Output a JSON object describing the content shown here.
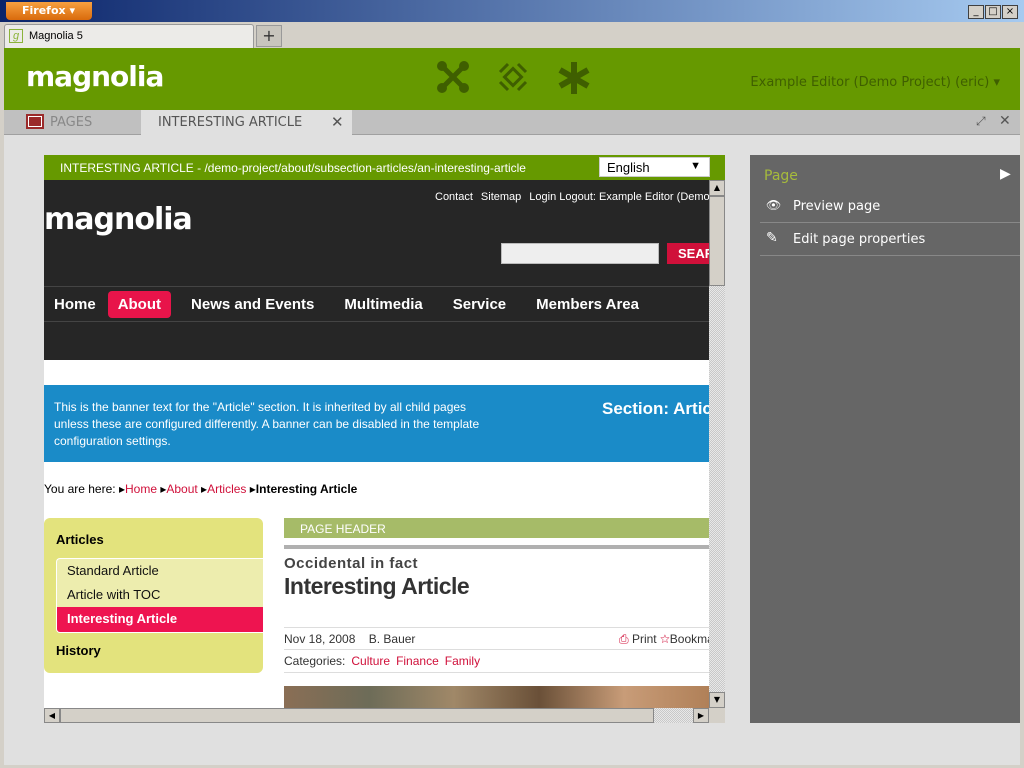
{
  "browser": {
    "menu_label": "Firefox",
    "tab_title": "Magnolia 5",
    "new_tab": "+",
    "win_min": "_",
    "win_max": "□",
    "win_close": "×"
  },
  "app": {
    "logo": "magnolia",
    "user": "Example Editor (Demo Project) (eric)",
    "apps": [
      "pulse-icon",
      "favorites-icon",
      "asterisk-icon"
    ],
    "accent": "#669900"
  },
  "apptabs": {
    "pages": "PAGES",
    "article": "INTERESTING ARTICLE",
    "close": "✕",
    "maximize": "⤢",
    "close_all": "✕"
  },
  "preview": {
    "path": "INTERESTING ARTICLE - /demo-project/about/subsection-articles/an-interesting-article",
    "language": "English",
    "site": {
      "logo": "magnolia",
      "top_links": [
        "Contact",
        "Sitemap",
        "Login Logout: Example Editor (Demo Project)"
      ],
      "search_button": "SEARCH",
      "nav": [
        "Home",
        "About",
        "News and Events",
        "Multimedia",
        "Service",
        "Members Area"
      ],
      "banner_text": "This is the banner text for the \"Article\" section. It is inherited by all child pages unless these are configured differently. A banner can be disabled in the template configuration settings.",
      "banner_title": "Section: Articles",
      "breadcrumb": {
        "label": "You are here:",
        "items": [
          "Home",
          "About",
          "Articles"
        ],
        "current": "Interesting Article"
      },
      "leftnav": {
        "heading": "Articles",
        "items": [
          "Standard Article",
          "Article with TOC",
          "Interesting Article"
        ],
        "footer": "History"
      },
      "page_header": "PAGE HEADER",
      "subtitle": "Occidental in fact",
      "title": "Interesting Article",
      "date": "Nov 18, 2008",
      "author": "B. Bauer",
      "print": "Print",
      "bookmark": "Bookmark",
      "categories_label": "Categories:",
      "categories": [
        "Culture",
        "Finance",
        "Family"
      ]
    }
  },
  "panel": {
    "heading": "Page",
    "actions": [
      "Preview page",
      "Edit page properties"
    ]
  }
}
